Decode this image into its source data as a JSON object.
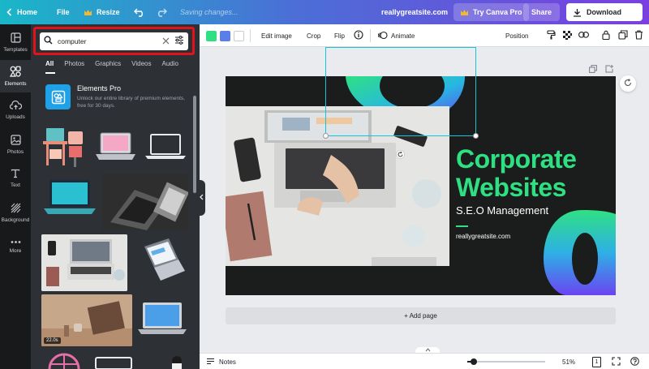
{
  "topbar": {
    "home_label": "Home",
    "file_label": "File",
    "resize_label": "Resize",
    "saving_text": "Saving changes...",
    "site_name": "reallygreatsite.com",
    "try_pro_label": "Try Canva Pro",
    "share_label": "Share",
    "download_label": "Download"
  },
  "rail": {
    "items": [
      {
        "label": "Templates",
        "icon": "templates-icon"
      },
      {
        "label": "Elements",
        "icon": "elements-icon",
        "active": true
      },
      {
        "label": "Uploads",
        "icon": "upload-icon"
      },
      {
        "label": "Photos",
        "icon": "photos-icon"
      },
      {
        "label": "Text",
        "icon": "text-icon"
      },
      {
        "label": "Background",
        "icon": "background-icon"
      },
      {
        "label": "More",
        "icon": "more-icon"
      }
    ]
  },
  "panel": {
    "search": {
      "value": "computer"
    },
    "tabs": [
      "All",
      "Photos",
      "Graphics",
      "Videos",
      "Audio"
    ],
    "active_tab": "All",
    "promo": {
      "title": "Elements Pro",
      "description": "Unlock our entire library of premium elements, free for 30 days."
    },
    "video_duration": "22.0s"
  },
  "toolbar": {
    "colors": [
      "#2fe083",
      "#5b7fe8",
      "#ffffff"
    ],
    "edit_image_label": "Edit image",
    "crop_label": "Crop",
    "flip_label": "Flip",
    "animate_label": "Animate",
    "position_label": "Position"
  },
  "design": {
    "title_line1": "Corporate",
    "title_line2": "Websites",
    "subtitle": "S.E.O Management",
    "site": "reallygreatsite.com",
    "accent_color": "#2fe083"
  },
  "canvas": {
    "add_page_label": "+ Add page"
  },
  "bottombar": {
    "notes_label": "Notes",
    "zoom_label": "51%",
    "zoom_fraction": 0.08,
    "page_number": "1"
  }
}
